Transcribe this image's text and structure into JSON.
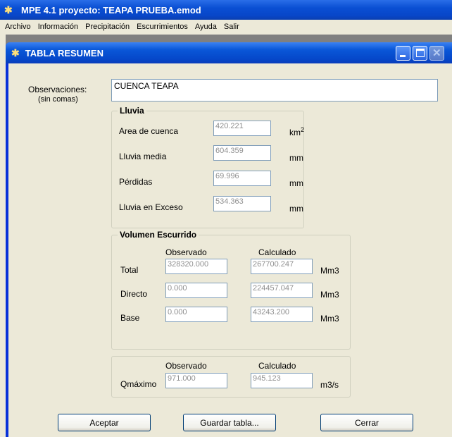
{
  "app": {
    "title": "MPE 4.1 proyecto: TEAPA PRUEBA.emod"
  },
  "menu": [
    "Archivo",
    "Información",
    "Precipitación",
    "Escurrimientos",
    "Ayuda",
    "Salir"
  ],
  "dialog": {
    "title": "TABLA RESUMEN",
    "observaciones": {
      "label": "Observaciones:",
      "sublabel": "(sin comas)",
      "value": "CUENCA TEAPA"
    },
    "lluvia": {
      "title": "Lluvia",
      "rows": [
        {
          "label": "Area de cuenca",
          "value": "420.221",
          "unit": "km",
          "unit_sup": "2"
        },
        {
          "label": "Lluvia media",
          "value": "604.359",
          "unit": "mm"
        },
        {
          "label": "Pérdidas",
          "value": "69.996",
          "unit": "mm"
        },
        {
          "label": "Lluvia en Exceso",
          "value": "534.363",
          "unit": "mm"
        }
      ]
    },
    "volumen": {
      "title": "Volumen Escurrido",
      "col_observado": "Observado",
      "col_calculado": "Calculado",
      "rows": [
        {
          "label": "Total",
          "observado": "328320.000",
          "calculado": "267700.247",
          "unit": "Mm3"
        },
        {
          "label": "Directo",
          "observado": "0.000",
          "calculado": "224457.047",
          "unit": "Mm3"
        },
        {
          "label": "Base",
          "observado": "0.000",
          "calculado": "43243.200",
          "unit": "Mm3"
        }
      ]
    },
    "qmax": {
      "col_observado": "Observado",
      "col_calculado": "Calculado",
      "label": "Qmáximo",
      "observado": "971.000",
      "calculado": "945.123",
      "unit": "m3/s"
    },
    "buttons": {
      "aceptar": "Aceptar",
      "guardar": "Guardar tabla...",
      "cerrar": "Cerrar"
    }
  }
}
